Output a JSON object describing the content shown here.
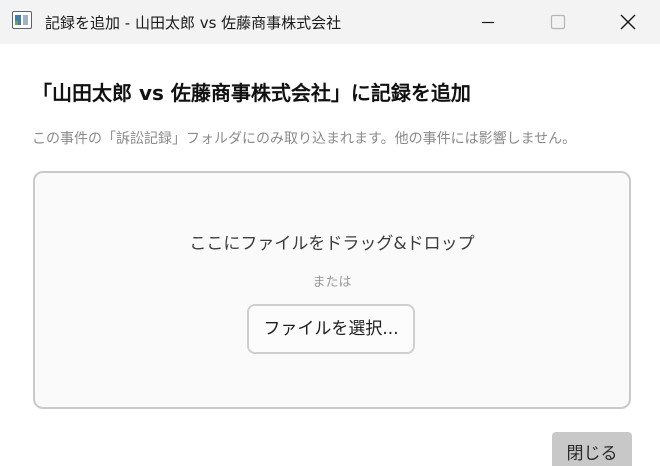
{
  "window": {
    "title": "記録を追加 - 山田太郎 vs 佐藤商事株式会社",
    "icon": "app-window-icon",
    "controls": {
      "minimize_icon": "minimize-icon",
      "maximize_icon": "maximize-icon",
      "close_icon": "close-icon"
    }
  },
  "dialog": {
    "heading": "「山田太郎 vs 佐藤商事株式会社」に記録を追加",
    "description": "この事件の「訴訟記録」フォルダにのみ取り込まれます。他の事件には影響しません。",
    "dropzone": {
      "instruction": "ここにファイルをドラッグ&ドロップ",
      "or_label": "または",
      "select_button_label": "ファイルを選択..."
    },
    "close_button_label": "閉じる"
  },
  "colors": {
    "titlebar_bg": "#f3f3f3",
    "dropzone_border": "#c9c9c9",
    "dropzone_bg": "#fafafa",
    "close_button_bg": "#c8c8c8",
    "description_text": "#8a8a8a"
  }
}
